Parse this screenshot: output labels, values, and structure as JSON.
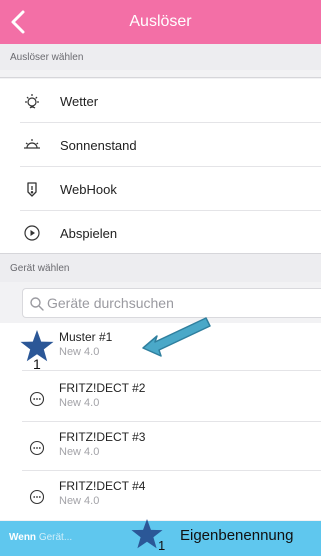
{
  "header": {
    "title": "Auslöser",
    "back_icon": "chevron-left-icon",
    "background": "#f36fa6"
  },
  "triggers": {
    "section_label": "Auslöser wählen",
    "items": [
      {
        "label": "Wetter",
        "icon": "weather-icon"
      },
      {
        "label": "Sonnenstand",
        "icon": "sun-icon"
      },
      {
        "label": "WebHook",
        "icon": "webhook-icon"
      },
      {
        "label": "Abspielen",
        "icon": "play-icon"
      }
    ]
  },
  "devices": {
    "section_label": "Gerät wählen",
    "search_placeholder": "Geräte durchsuchen",
    "items": [
      {
        "name": "Muster #1",
        "sub": "New 4.0"
      },
      {
        "name": "FRITZ!DECT #2",
        "sub": "New 4.0"
      },
      {
        "name": "FRITZ!DECT #3",
        "sub": "New 4.0"
      },
      {
        "name": "FRITZ!DECT #4",
        "sub": "New 4.0"
      }
    ]
  },
  "annotations": {
    "star_subscript": "1",
    "footer_note": "Eigenbenennung",
    "star_color": "#2b5797",
    "arrow_color": "#4aa8c8"
  },
  "footer": {
    "bold": "Wenn",
    "text": "Gerät...",
    "background": "#5fc7ee"
  }
}
